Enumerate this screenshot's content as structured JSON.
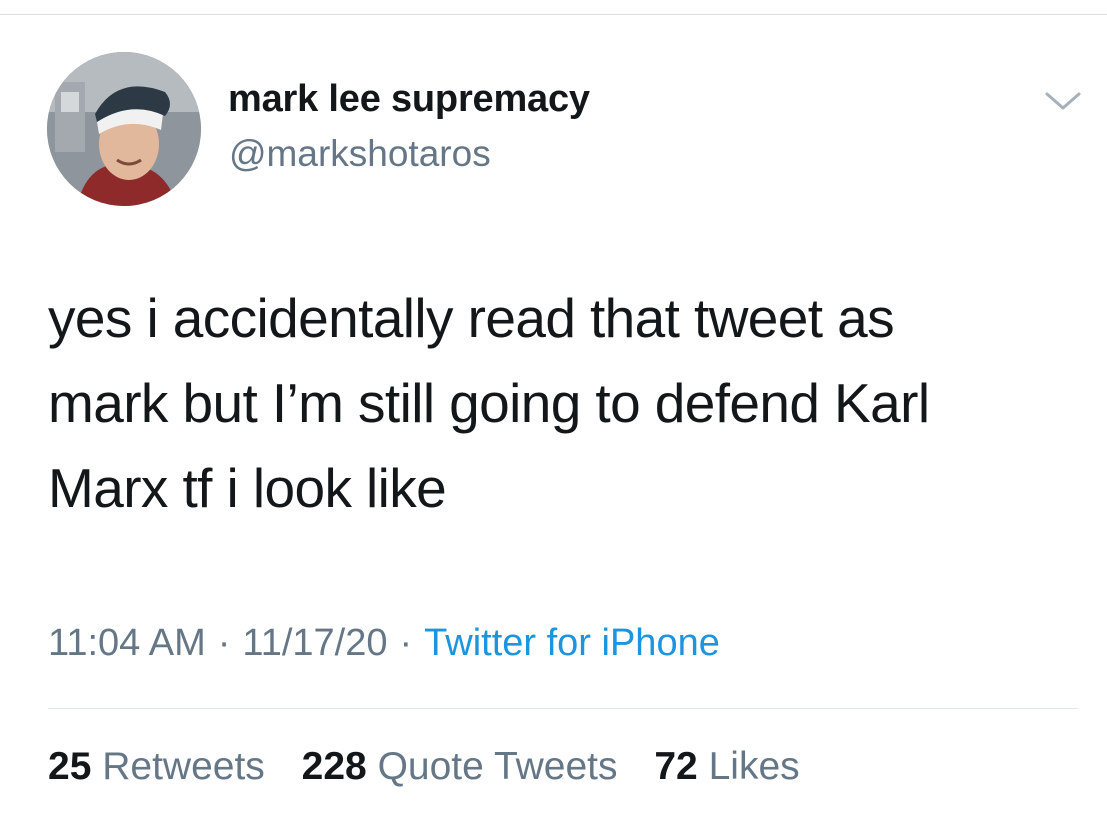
{
  "tweet": {
    "display_name": "mark lee supremacy",
    "handle": "@markshotaros",
    "text_lines": [
      "yes i accidentally read that tweet as",
      "mark but I’m still going to defend Karl",
      "Marx tf i look like"
    ],
    "time": "11:04 AM",
    "date": "11/17/20",
    "separator": "·",
    "source": "Twitter for iPhone",
    "stats": {
      "retweets_count": "25",
      "retweets_label": "Retweets",
      "quotes_count": "228",
      "quotes_label": "Quote Tweets",
      "likes_count": "72",
      "likes_label": "Likes"
    },
    "menu_icon": "chevron-down-icon",
    "colors": {
      "link": "#1b95e0",
      "secondary_text": "#657786",
      "primary_text": "#14171a"
    }
  }
}
